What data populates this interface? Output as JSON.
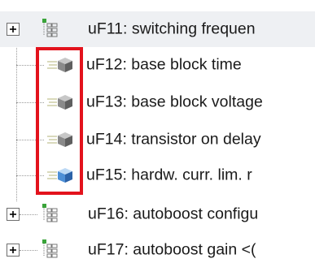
{
  "tree": {
    "items": [
      {
        "label": "uF11: switching frequen",
        "kind": "parent",
        "expander": "+",
        "icon": "parameter-group-icon"
      },
      {
        "label": "uF12: base block time",
        "kind": "leaf",
        "icon": "gray-cube-icon"
      },
      {
        "label": "uF13: base block voltage",
        "kind": "leaf",
        "icon": "gray-cube-icon"
      },
      {
        "label": "uF14: transistor on delay",
        "kind": "leaf",
        "icon": "gray-cube-icon"
      },
      {
        "label": "uF15: hardw. curr. lim. r",
        "kind": "leaf",
        "icon": "blue-cube-icon"
      },
      {
        "label": "uF16: autoboost configu",
        "kind": "parent",
        "expander": "+",
        "icon": "parameter-group-icon"
      },
      {
        "label": "uF17: autoboost gain <(",
        "kind": "parent",
        "expander": "+",
        "icon": "parameter-group-icon"
      }
    ]
  },
  "colors": {
    "highlight_border": "#e3121c",
    "gray_cube": "#8a8a8a",
    "blue_cube": "#4d8fd6",
    "folder_green": "#3aa43a"
  }
}
